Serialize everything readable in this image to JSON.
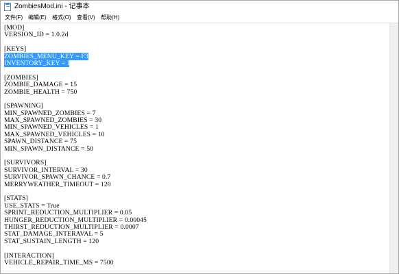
{
  "window": {
    "title": "ZombiesMod.ini - 记事本"
  },
  "menu": {
    "items": [
      "文件(F)",
      "编辑(E)",
      "格式(O)",
      "查看(V)",
      "帮助(H)"
    ]
  },
  "editor": {
    "selected_lines": [
      4,
      5
    ],
    "lines": [
      "[MOD]",
      "VERSION_ID = 1.0.2d",
      "",
      "[KEYS]",
      "ZOMBIES_MENU_KEY = F3",
      "INVENTORY_KEY = I",
      "",
      "[ZOMBIES]",
      "ZOMBIE_DAMAGE = 15",
      "ZOMBIE_HEALTH = 750",
      "",
      "[SPAWNING]",
      "MIN_SPAWNED_ZOMBIES = 7",
      "MAX_SPAWNED_ZOMBIES = 30",
      "MIN_SPAWNED_VEHICLES = 1",
      "MAX_SPAWNED_VEHICLES = 10",
      "SPAWN_DISTANCE = 75",
      "MIN_SPAWN_DISTANCE = 50",
      "",
      "[SURVIVORS]",
      "SURVIVOR_INTERVAL = 30",
      "SURVIVOR_SPAWN_CHANCE = 0.7",
      "MERRYWEATHER_TIMEOUT = 120",
      "",
      "[STATS]",
      "USE_STATS = True",
      "SPRINT_REDUCTION_MULTIPLIER = 0.05",
      "HUNGER_REDUCTION_MULTIPLIER = 0.00045",
      "THIRST_REDUCTION_MULTIPLIER = 0.0007",
      "STAT_DAMAGE_INTERAVAL = 5",
      "STAT_SUSTAIN_LENGTH = 120",
      "",
      "[INTERACTION]",
      "VEHICLE_REPAIR_TIME_MS = 7500"
    ]
  }
}
